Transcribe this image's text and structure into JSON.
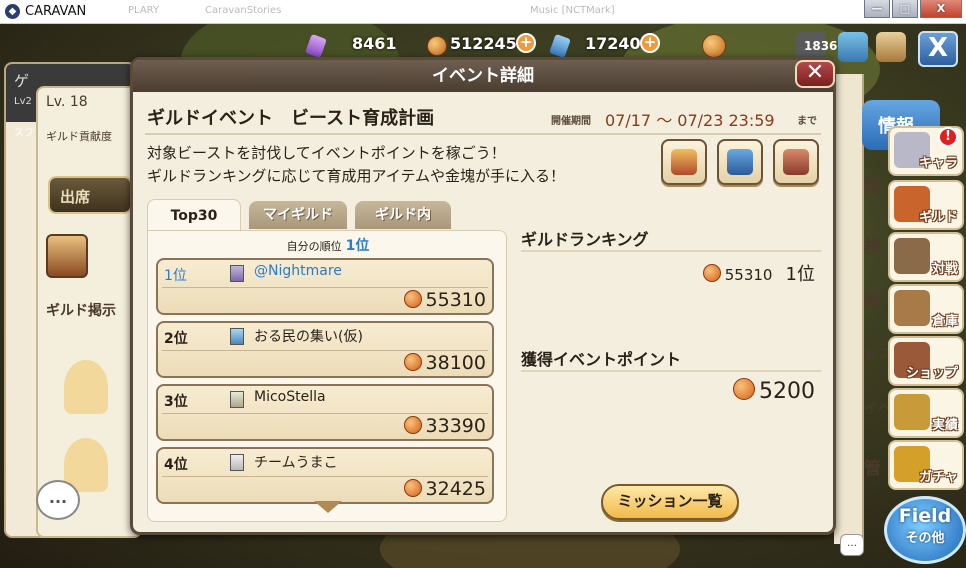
{
  "window": {
    "title": "CARAVAN",
    "ghost_tabs": [
      "PLARY",
      "CaravanStories",
      "Music [NCTMark]"
    ],
    "controls": [
      "—",
      "□",
      "X"
    ]
  },
  "topbar": {
    "gems": "8461",
    "gold": "512245",
    "stamina": "17240",
    "badge": "1836",
    "plus": "+",
    "close": "X"
  },
  "background_left": {
    "name_partial": "ゲ",
    "lv_small": "Lv2",
    "sp": "スフ",
    "level": "Lv. 18",
    "contribution": "ギルド貢献度",
    "attend": "出席",
    "board": "ギルド掲示",
    "chat": "..."
  },
  "background_right": {
    "info_tab": "情報",
    "letters": [
      "特",
      "検",
      "掲",
      "ヒス",
      "イベ",
      "管"
    ]
  },
  "side_menu": [
    {
      "label": "キャラ",
      "icon": "helmet-icon",
      "color": "#b8b8c8"
    },
    {
      "label": "ギルド",
      "icon": "guild-banner-icon",
      "color": "#c8642c"
    },
    {
      "label": "対戦",
      "icon": "battle-icon",
      "color": "#8a6a48"
    },
    {
      "label": "倉庫",
      "icon": "warehouse-icon",
      "color": "#a87a48"
    },
    {
      "label": "ショップ",
      "icon": "shop-icon",
      "color": "#9a5a3a"
    },
    {
      "label": "実績",
      "icon": "achievement-medal-icon",
      "color": "#c89a3a"
    },
    {
      "label": "ガチャ",
      "icon": "treasure-chest-icon",
      "color": "#d4a02a"
    }
  ],
  "side_alert": "!",
  "field_button": {
    "line1": "Field",
    "line2": "その他"
  },
  "dialog": {
    "header": "イベント詳細",
    "close": "✕",
    "event_title": "ギルドイベント　ビースト育成計画",
    "period_label": "開催期間",
    "period_value": "07/17 〜 07/23 23:59",
    "period_suffix": "まで",
    "description_line1": "対象ビーストを討伐してイベントポイントを稼ごう！",
    "description_line2": "ギルドランキングに応じて育成用アイテムや金塊が手に入る！"
  },
  "reward_icons": [
    "beast-hint-icon",
    "treasure-chest-icon",
    "shop-house-icon"
  ],
  "tabs": [
    "Top30",
    "マイギルド",
    "ギルド内"
  ],
  "ranking_list": {
    "self_rank_label": "自分の順位",
    "self_rank_value": "1位",
    "rows": [
      {
        "rank": "1位",
        "name": "@Nightmare",
        "points": "55310"
      },
      {
        "rank": "2位",
        "name": "おる民の集い(仮)",
        "points": "38100"
      },
      {
        "rank": "3位",
        "name": "MicoStella",
        "points": "33390"
      },
      {
        "rank": "4位",
        "name": "チームうまこ",
        "points": "32425"
      }
    ]
  },
  "guild_ranking": {
    "title": "ギルドランキング",
    "points": "55310",
    "rank": "1位"
  },
  "event_points": {
    "title": "獲得イベントポイント",
    "points": "5200"
  },
  "mission_button": "ミッション一覧"
}
